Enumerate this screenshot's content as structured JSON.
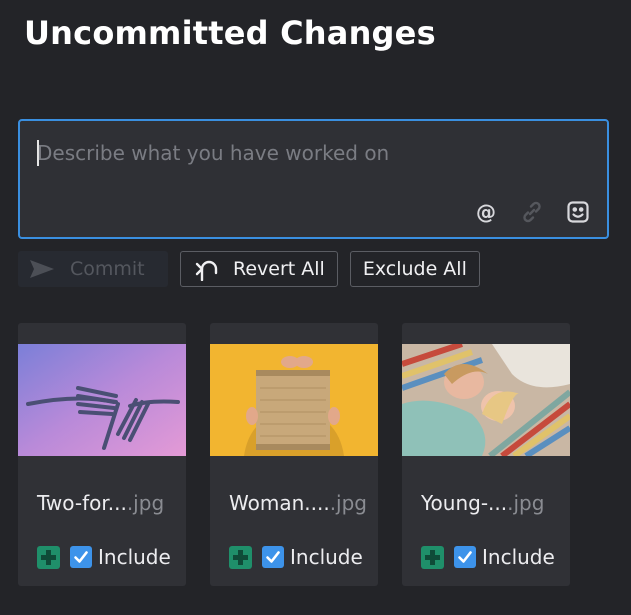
{
  "page": {
    "title": "Uncommitted Changes"
  },
  "commit_box": {
    "placeholder": "Describe what you have worked on",
    "icons": [
      "at-mention-icon",
      "link-icon",
      "emoji-icon"
    ],
    "at_symbol": "@"
  },
  "actions": {
    "commit_label": "Commit",
    "revert_label": "Revert All",
    "exclude_label": "Exclude All"
  },
  "files": [
    {
      "name": "Two-for...",
      "ext": ".jpg",
      "status_icon": "added-icon",
      "include_label": "Include",
      "included": true
    },
    {
      "name": "Woman....",
      "ext": ".jpg",
      "status_icon": "added-icon",
      "include_label": "Include",
      "included": true
    },
    {
      "name": "Young-...",
      "ext": ".jpg",
      "status_icon": "added-icon",
      "include_label": "Include",
      "included": true
    }
  ],
  "colors": {
    "accent": "#3a8fe0",
    "added": "#1f8f6a",
    "background": "#232428",
    "card": "#303136"
  }
}
